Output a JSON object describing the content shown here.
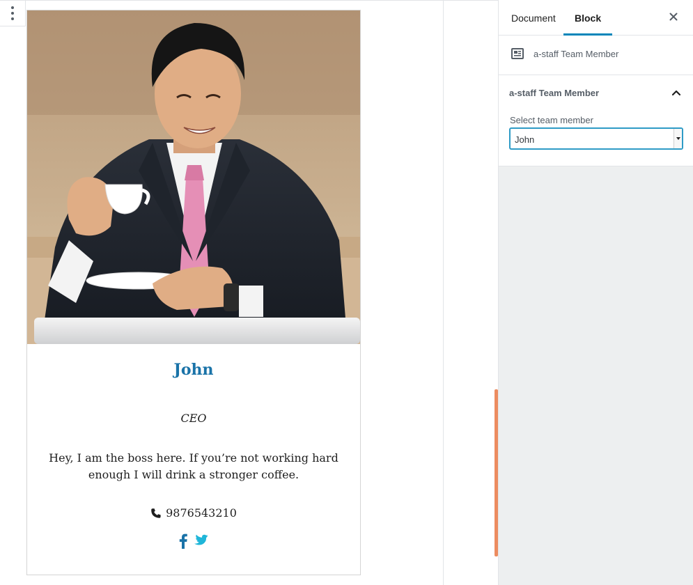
{
  "sidebar": {
    "tabs": [
      {
        "label": "Document",
        "active": false
      },
      {
        "label": "Block",
        "active": true
      }
    ],
    "close_icon": "close-icon",
    "block_card": {
      "icon": "id-card-icon",
      "title": "a-staff Team Member"
    },
    "panel": {
      "title": "a-staff Team Member",
      "expanded": true,
      "field_label": "Select team member",
      "selected": "John"
    }
  },
  "member": {
    "name": "John",
    "role": "CEO",
    "bio": "Hey, I am the boss here. If you’re not working hard enough I will drink a stronger coffee.",
    "phone": "9876543210",
    "phone_icon": "phone-icon",
    "social": [
      {
        "icon": "facebook-icon",
        "color": "#1a73a8"
      },
      {
        "icon": "twitter-icon",
        "color": "#1fb6d9"
      }
    ]
  },
  "colors": {
    "accent": "#0085ba",
    "name": "#1a73a8",
    "scrollbar": "#ec8c60"
  }
}
